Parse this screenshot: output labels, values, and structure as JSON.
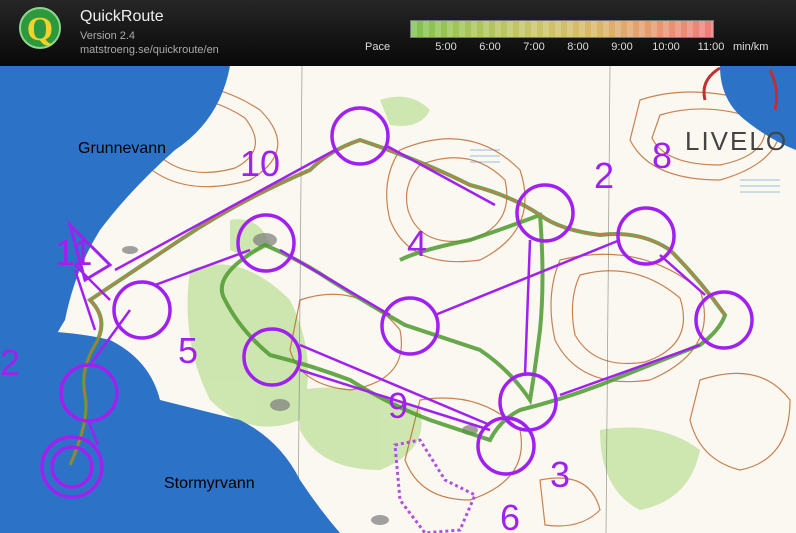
{
  "app": {
    "title": "QuickRoute",
    "version": "Version 2.4",
    "url": "matstroeng.se/quickroute/en"
  },
  "pace_scale": {
    "label": "Pace",
    "ticks": [
      "5:00",
      "6:00",
      "7:00",
      "8:00",
      "9:00",
      "10:00",
      "11:00"
    ],
    "unit": "min/km",
    "gradient_colors": [
      "#7fc24d",
      "#a9c45a",
      "#c8c66a",
      "#d9b86a",
      "#e49a70",
      "#ef7d7d"
    ]
  },
  "map": {
    "lake_labels": [
      "Grunnevann",
      "Stormyrvann"
    ],
    "control_numbers": [
      "10",
      "2",
      "8",
      "11",
      "4",
      "5",
      "2",
      "9",
      "3",
      "6"
    ],
    "logo_text": "LIVELO",
    "colors": {
      "course": "#a020f0",
      "water": "#2c73c8",
      "terrain": "#ffffff",
      "contour": "#b85b1a",
      "vegetation": "#c6e4a4"
    }
  }
}
